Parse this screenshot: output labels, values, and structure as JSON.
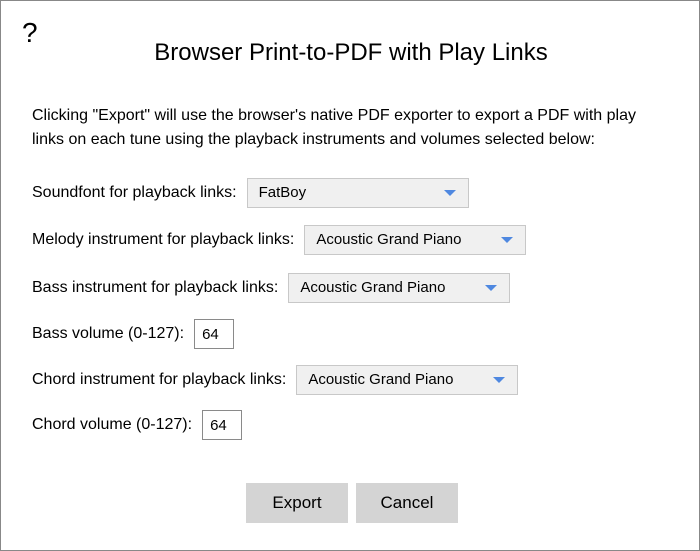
{
  "dialog": {
    "help_label": "?",
    "title": "Browser Print-to-PDF with Play Links",
    "description": "Clicking \"Export\" will use the browser's native PDF exporter to export a PDF with play links on each tune using the playback instruments and volumes selected below:"
  },
  "fields": {
    "soundfont": {
      "label": "Soundfont for playback links:",
      "value": "FatBoy",
      "caret_icon": "caret-down-icon"
    },
    "melody": {
      "label": "Melody instrument for playback links:",
      "value": "Acoustic Grand Piano",
      "caret_icon": "caret-down-icon"
    },
    "bass": {
      "label": "Bass instrument for playback links:",
      "value": "Acoustic Grand Piano",
      "caret_icon": "caret-down-icon"
    },
    "bass_volume": {
      "label": "Bass volume (0-127):",
      "value": "64"
    },
    "chord": {
      "label": "Chord instrument for playback links:",
      "value": "Acoustic Grand Piano",
      "caret_icon": "caret-down-icon"
    },
    "chord_volume": {
      "label": "Chord volume (0-127):",
      "value": "64"
    }
  },
  "buttons": {
    "export": "Export",
    "cancel": "Cancel"
  },
  "colors": {
    "caret": "#4f88e0",
    "button_bg": "#d4d4d4",
    "select_bg": "#f0f0f0"
  }
}
